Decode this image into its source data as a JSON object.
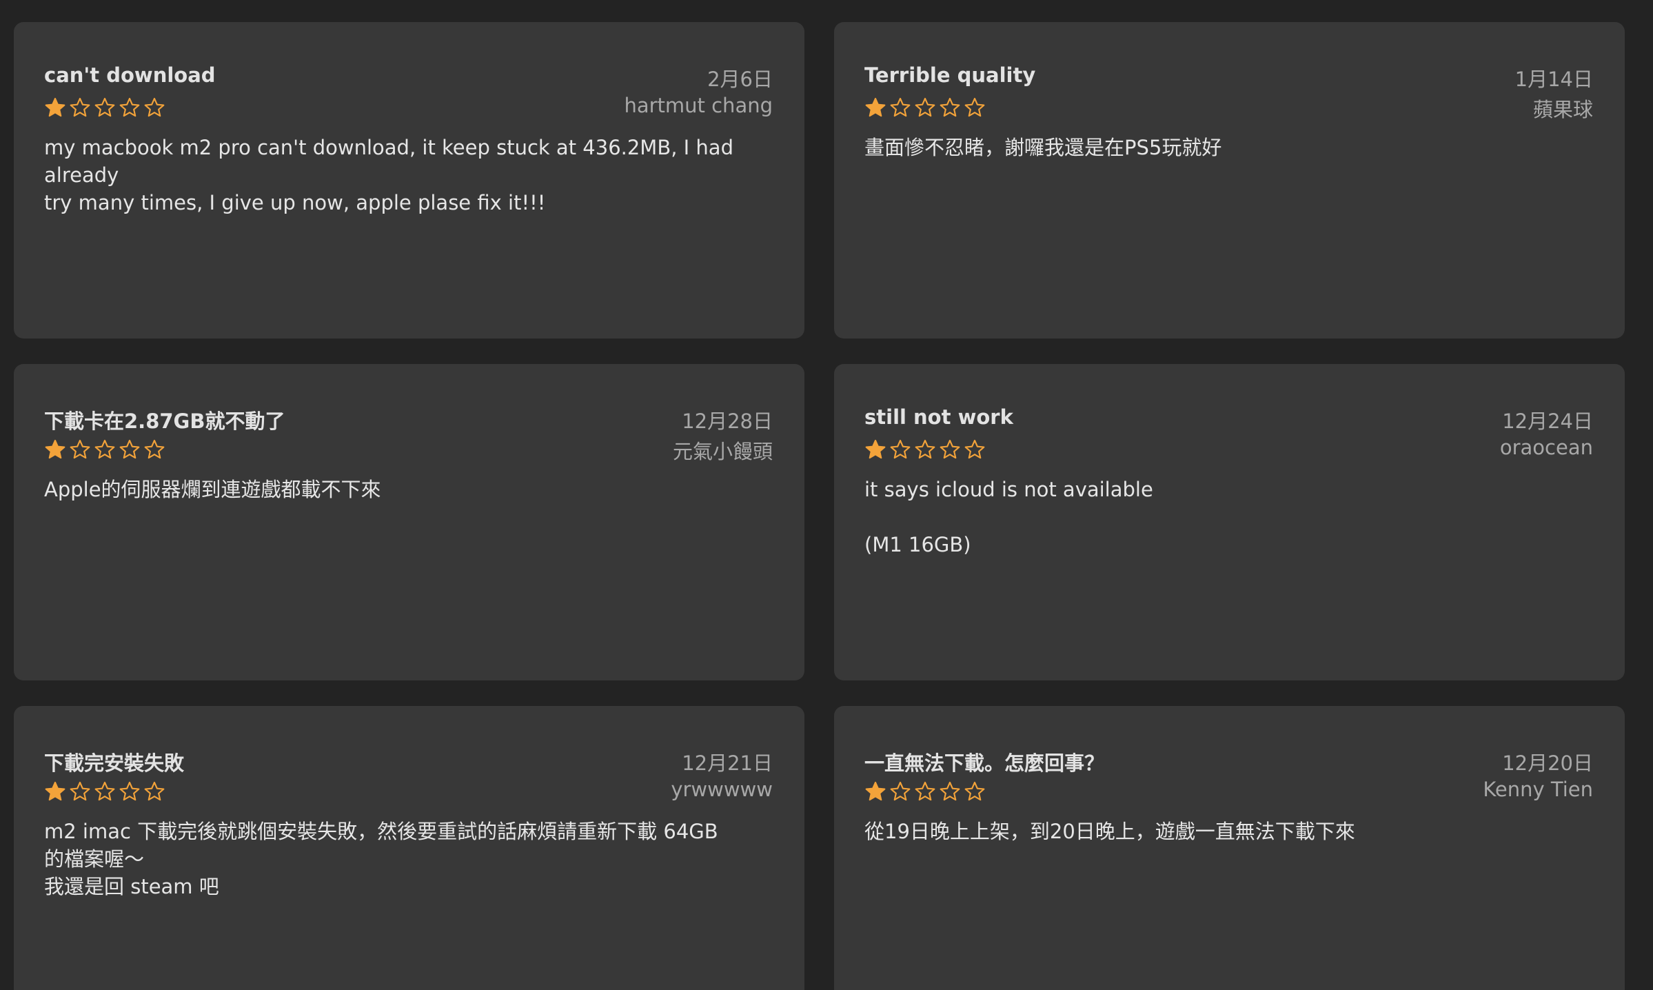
{
  "colors": {
    "background": "#232323",
    "card": "#383838",
    "star": "#f3a33a",
    "text": "#e6e6e6",
    "meta": "#a8a8a8"
  },
  "icons": {
    "filled": "star-filled-icon",
    "empty": "star-outline-icon"
  },
  "reviews": [
    {
      "title": "can't download",
      "date": "2月6日",
      "author": "hartmut chang",
      "rating": 1,
      "body_lines": [
        "my macbook m2 pro can't download, it keep stuck at 436.2MB, I had already",
        "try many times, I give up now, apple plase fix it!!!"
      ]
    },
    {
      "title": "Terrible quality",
      "date": "1月14日",
      "author": "蘋果球",
      "rating": 1,
      "body_lines": [
        "畫面慘不忍睹，謝囉我還是在PS5玩就好"
      ]
    },
    {
      "title": "下載卡在2.87GB就不動了",
      "date": "12月28日",
      "author": "元氣小饅頭",
      "rating": 1,
      "body_lines": [
        "Apple的伺服器爛到連遊戲都載不下來"
      ]
    },
    {
      "title": "still not work",
      "date": "12月24日",
      "author": "oraocean",
      "rating": 1,
      "body_lines": [
        "it says icloud is not available",
        "",
        "(M1 16GB)"
      ]
    },
    {
      "title": "下載完安裝失敗",
      "date": "12月21日",
      "author": "yrwwwww",
      "rating": 1,
      "body_lines": [
        "m2 imac 下載完後就跳個安裝失敗，然後要重試的話麻煩請重新下載 64GB",
        "的檔案喔～",
        "我還是回 steam 吧"
      ]
    },
    {
      "title": "一直無法下載。怎麼回事？",
      "date": "12月20日",
      "author": "Kenny Tien",
      "rating": 1,
      "body_lines": [
        "從19日晚上上架，到20日晚上，遊戲一直無法下載下來"
      ]
    }
  ]
}
